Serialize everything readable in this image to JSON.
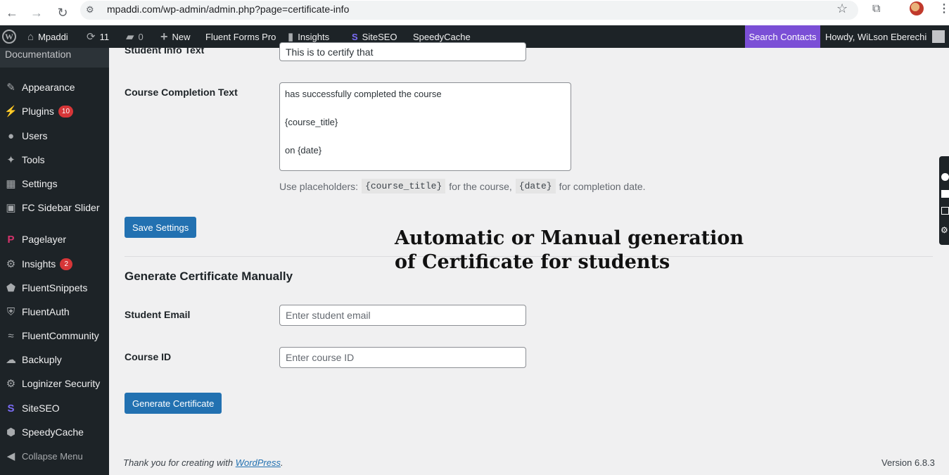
{
  "browser": {
    "url": "mpaddi.com/wp-admin/admin.php?page=certificate-info"
  },
  "admin_bar": {
    "site_name": "Mpaddi",
    "updates_count": "11",
    "comments_count": "0",
    "new_label": "New",
    "fluent_forms": "Fluent Forms Pro",
    "insights": "Insights",
    "siteseo": "SiteSEO",
    "speedycache": "SpeedyCache",
    "search_contacts": "Search Contacts",
    "howdy": "Howdy, WiLson Eberechi"
  },
  "sidebar": {
    "documentation": "Documentation",
    "items": [
      {
        "label": "Appearance",
        "icon": "paintbrush-icon"
      },
      {
        "label": "Plugins",
        "icon": "plugin-icon",
        "badge": "10"
      },
      {
        "label": "Users",
        "icon": "users-icon"
      },
      {
        "label": "Tools",
        "icon": "wrench-icon"
      },
      {
        "label": "Settings",
        "icon": "settings-icon"
      },
      {
        "label": "FC Sidebar Slider",
        "icon": "slider-icon"
      },
      {
        "label": "Pagelayer",
        "icon": "pagelayer-icon"
      },
      {
        "label": "Insights",
        "icon": "insights-icon",
        "badge": "2"
      },
      {
        "label": "FluentSnippets",
        "icon": "code-shield-icon"
      },
      {
        "label": "FluentAuth",
        "icon": "shield-icon"
      },
      {
        "label": "FluentCommunity",
        "icon": "community-icon"
      },
      {
        "label": "Backuply",
        "icon": "cloud-upload-icon"
      },
      {
        "label": "Loginizer Security",
        "icon": "gear-icon"
      },
      {
        "label": "SiteSEO",
        "icon": "siteseo-icon"
      },
      {
        "label": "SpeedyCache",
        "icon": "speedycache-icon"
      }
    ],
    "collapse": "Collapse Menu"
  },
  "form": {
    "student_info_label": "Student Info Text",
    "student_info_value": "This is to certify that",
    "course_completion_label": "Course Completion Text",
    "course_completion_value": "has successfully completed the course\n\n{course_title}\n\non {date}",
    "desc_prefix": "Use placeholders:",
    "placeholder_course": "{course_title}",
    "desc_middle": "for the course,",
    "placeholder_date": "{date}",
    "desc_suffix": "for completion date.",
    "save_button": "Save Settings"
  },
  "overlay": {
    "line1": "Automatic or Manual generation",
    "line2": "of Certificate for students"
  },
  "manual": {
    "title": "Generate Certificate Manually",
    "email_label": "Student Email",
    "email_placeholder": "Enter student email",
    "course_label": "Course ID",
    "course_placeholder": "Enter course ID",
    "generate_button": "Generate Certificate"
  },
  "footer": {
    "thanks_prefix": "Thank you for creating with",
    "thanks_link": "WordPress",
    "thanks_suffix": ".",
    "version": "Version 6.8.3"
  }
}
